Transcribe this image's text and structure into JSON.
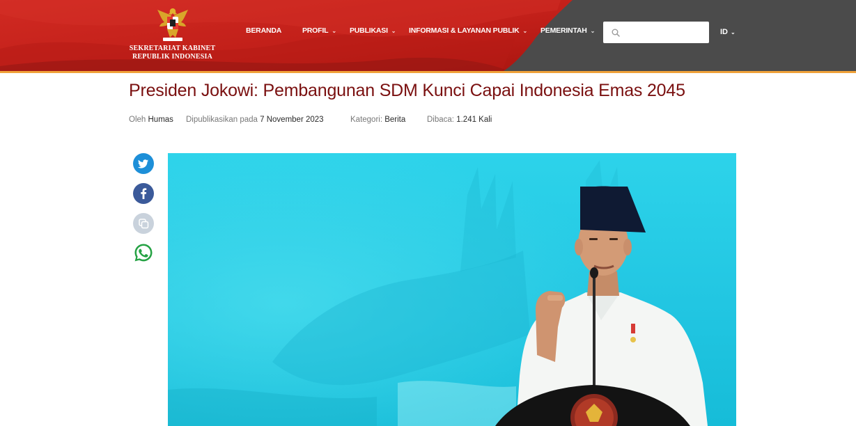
{
  "header": {
    "logo_line1": "SEKRETARIAT KABINET",
    "logo_line2": "REPUBLIK INDONESIA",
    "logo_icon": "garuda-icon",
    "colors": {
      "red": "#c8231d",
      "dark_red": "#8e1612",
      "gray": "#4b4b4b",
      "accent": "#f0a23a"
    }
  },
  "nav": {
    "items": [
      {
        "label": "BERANDA",
        "dropdown": false
      },
      {
        "label": "PROFIL",
        "dropdown": true
      },
      {
        "label": "PUBLIKASI",
        "dropdown": true
      },
      {
        "label": "INFORMASI & LAYANAN PUBLIK",
        "dropdown": true
      },
      {
        "label": "PEMERINTAH",
        "dropdown": true
      }
    ],
    "chevron": "⌄"
  },
  "search": {
    "placeholder": "",
    "value": "",
    "icon": "search-icon"
  },
  "language": {
    "label": "ID"
  },
  "article": {
    "title": "Presiden Jokowi: Pembangunan SDM Kunci Capai Indonesia Emas 2045",
    "meta": {
      "author_label": "Oleh",
      "author": "Humas",
      "published_label": "Dipublikasikan pada",
      "published": "7 November 2023",
      "category_label": "Kategori:",
      "category": "Berita",
      "views_label": "Dibaca:",
      "views": "1.241 Kali"
    }
  },
  "share": [
    {
      "name": "twitter",
      "icon": "twitter-icon",
      "color": "#1d8fd8"
    },
    {
      "name": "facebook",
      "icon": "facebook-icon",
      "color": "#3b5a9a"
    },
    {
      "name": "copy-link",
      "icon": "copy-icon",
      "color": "#c9d2dc"
    },
    {
      "name": "whatsapp",
      "icon": "whatsapp-icon",
      "color": "#25a244"
    }
  ],
  "photo": {
    "subject": "president-speaking-at-podium"
  }
}
